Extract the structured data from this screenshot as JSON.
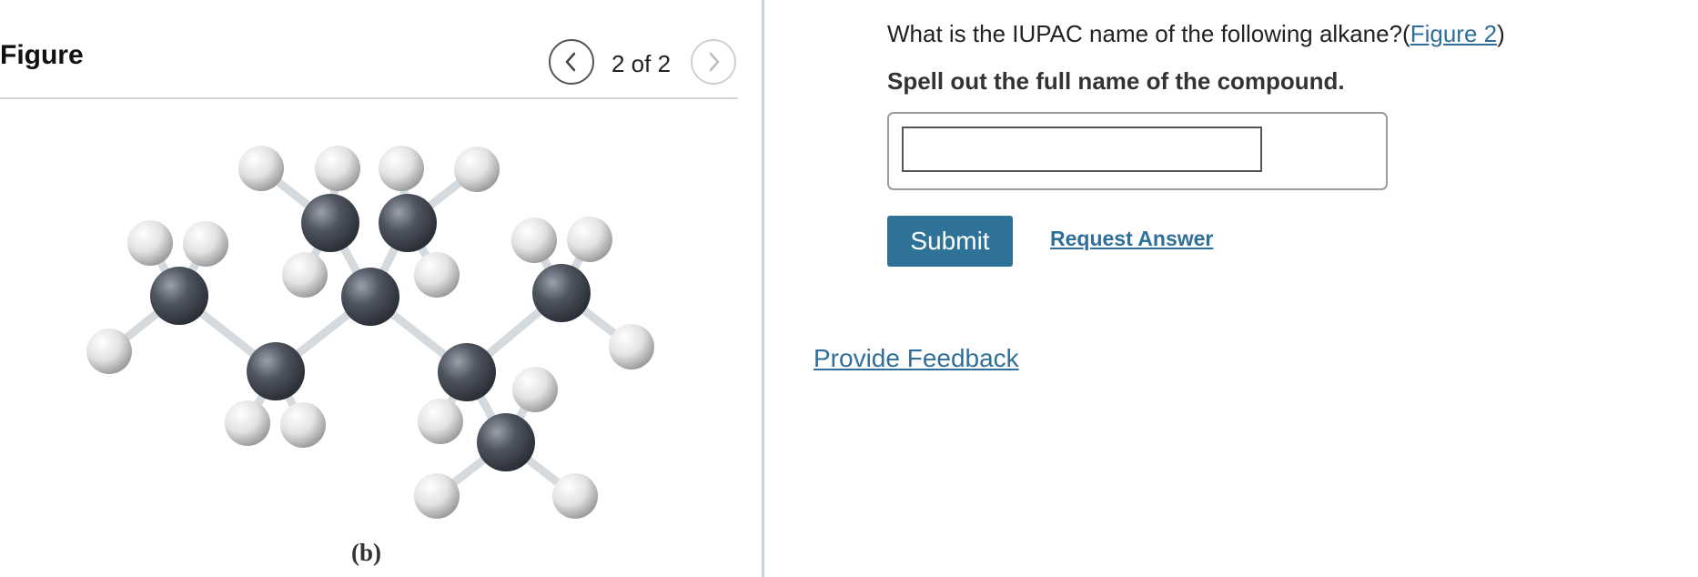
{
  "figure_panel": {
    "title": "Figure",
    "pagination": {
      "prev_icon": "chevron-left-icon",
      "indicator": "2 of 2",
      "next_icon": "chevron-right-icon"
    },
    "caption": "(b)",
    "molecule": {
      "carbon_color": "#4a4f5a",
      "hydrogen_color": "#e6e6e6",
      "bond_color": "#dfe3e6"
    }
  },
  "question": {
    "prompt_text": "What is the IUPAC name of the following alkane?(",
    "figure_link": "Figure 2",
    "prompt_close": ")",
    "instruction": "Spell out the full name of the compound.",
    "answer_value": ""
  },
  "actions": {
    "submit_label": "Submit",
    "request_answer_label": "Request Answer",
    "feedback_label": "Provide Feedback"
  },
  "colors": {
    "accent": "#2e7397",
    "link": "#2f6f9a"
  }
}
